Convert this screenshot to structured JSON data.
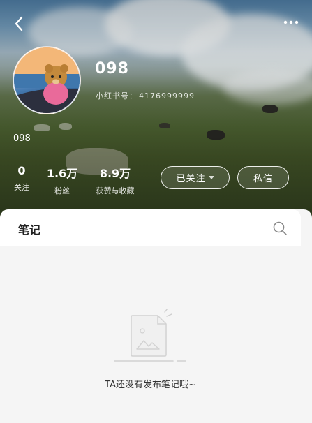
{
  "profile": {
    "nickname": "098",
    "red_id_label": "小红书号：",
    "red_id": "4176999999",
    "bio": "098"
  },
  "stats": [
    {
      "value": "0",
      "label": "关注"
    },
    {
      "value": "1.6万",
      "label": "粉丝"
    },
    {
      "value": "8.9万",
      "label": "获赞与收藏"
    }
  ],
  "actions": {
    "follow_label": "已关注",
    "message_label": "私信"
  },
  "tabs": {
    "notes_label": "笔记"
  },
  "empty_state": {
    "text": "TA还没有发布笔记哦~"
  },
  "icons": {
    "back": "chevron-left-icon",
    "more": "more-dots-icon",
    "search": "search-icon",
    "empty": "empty-document-icon"
  },
  "colors": {
    "text_dark": "#222222",
    "sheet_bg": "#f5f5f5",
    "white": "#ffffff"
  }
}
